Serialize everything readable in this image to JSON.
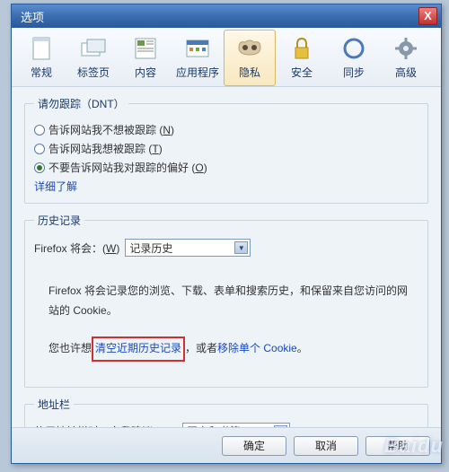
{
  "window": {
    "title": "选项",
    "close": "X"
  },
  "toolbar": {
    "items": [
      {
        "label": "常规"
      },
      {
        "label": "标签页"
      },
      {
        "label": "内容"
      },
      {
        "label": "应用程序"
      },
      {
        "label": "隐私"
      },
      {
        "label": "安全"
      },
      {
        "label": "同步"
      },
      {
        "label": "高级"
      }
    ]
  },
  "dnt": {
    "legend": "请勿跟踪（DNT）",
    "opt_no_track": "告诉网站我不想被跟踪 (",
    "opt_no_track_key": "N",
    "opt_track": "告诉网站我想被跟踪 (",
    "opt_track_key": "T",
    "opt_none": "不要告诉网站我对跟踪的偏好 (",
    "opt_none_key": "O",
    "close_paren": ")",
    "learn_more": "详细了解"
  },
  "history": {
    "legend": "历史记录",
    "prefix": "Firefox 将会：(",
    "key": "W",
    "close_paren": ")",
    "select_value": "记录历史",
    "desc": "Firefox 将会记录您的浏览、下载、表单和搜索历史，和保留来自您访问的网站的 Cookie。",
    "clear_pre": "您也许想",
    "clear_link": "清空近期历史记录",
    "clear_mid": "，或者",
    "remove_link": "移除单个 Cookie",
    "clear_end": "。"
  },
  "locationbar": {
    "legend": "地址栏",
    "label_pre": "使用地址栏时，向我建议：(",
    "key": "L",
    "close_paren": ")",
    "select_value": "历史和书签"
  },
  "buttons": {
    "ok": "确定",
    "cancel": "取消",
    "help": "帮助"
  },
  "watermark": "Baidu"
}
